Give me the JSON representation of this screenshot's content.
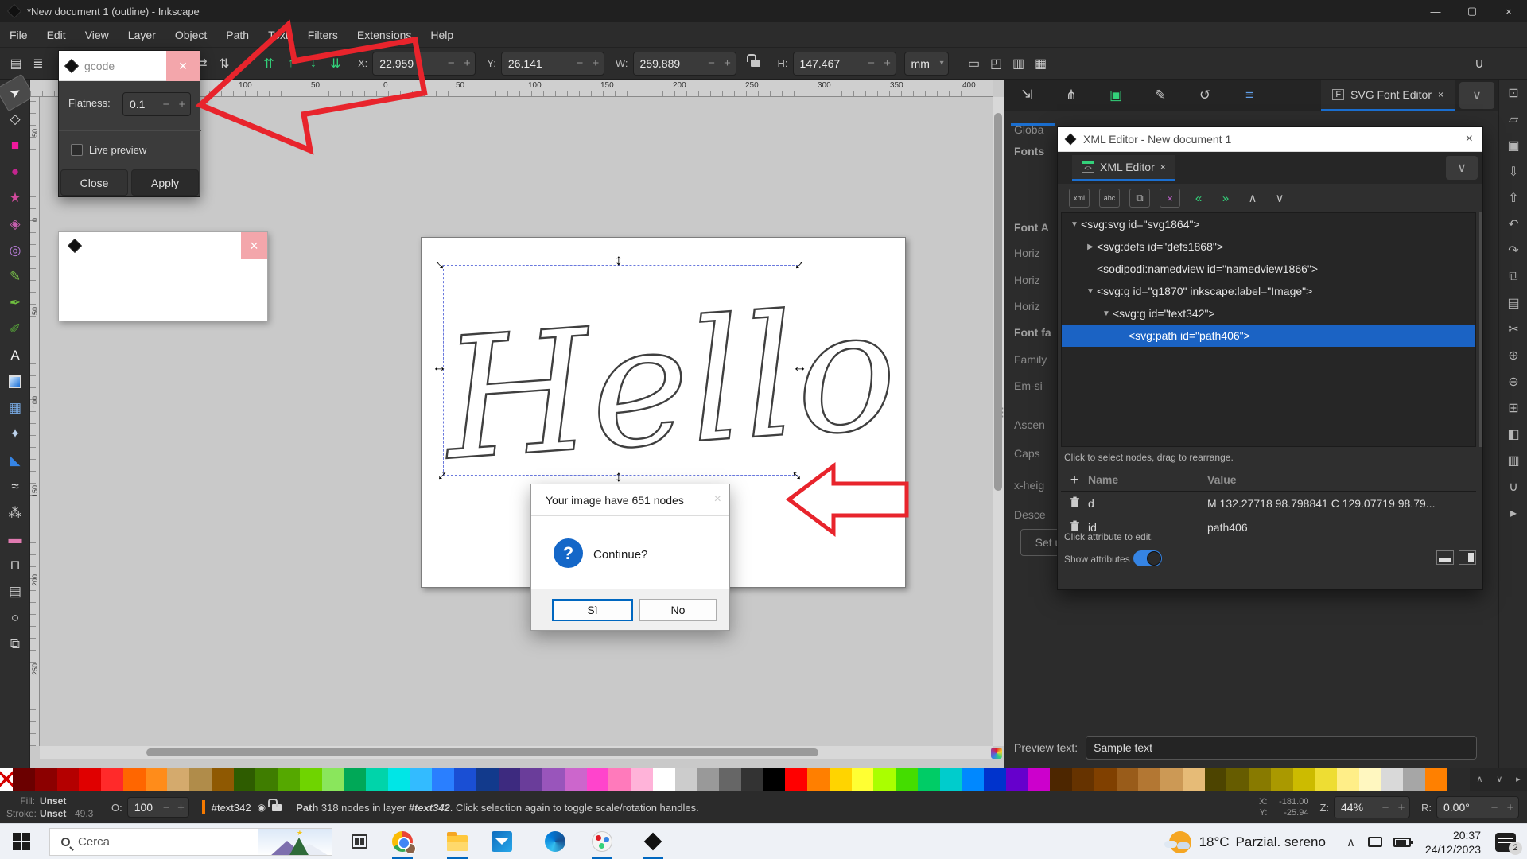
{
  "window": {
    "title": "*New document 1 (outline) - Inkscape"
  },
  "menus": [
    "File",
    "Edit",
    "View",
    "Layer",
    "Object",
    "Path",
    "Text",
    "Filters",
    "Extensions",
    "Help"
  ],
  "toolbar": {
    "x_label": "X:",
    "x_value": "22.959",
    "y_label": "Y:",
    "y_value": "26.141",
    "w_label": "W:",
    "w_value": "259.889",
    "h_label": "H:",
    "h_value": "147.467",
    "unit": "mm",
    "icons": [
      {
        "name": "object-properties-icon",
        "glyph": "▤"
      },
      {
        "name": "object-list-icon",
        "glyph": "≣"
      },
      {
        "name": "flip-horizontal-icon",
        "glyph": "⇄"
      },
      {
        "name": "flip-vertical-icon",
        "glyph": "⇅"
      },
      {
        "name": "raise-to-top-icon",
        "glyph": "⇈"
      },
      {
        "name": "raise-icon",
        "glyph": "↑"
      },
      {
        "name": "lower-icon",
        "glyph": "↓"
      },
      {
        "name": "lower-to-bottom-icon",
        "glyph": "⇊"
      },
      {
        "name": "scale-stroke-icon",
        "glyph": "▭"
      },
      {
        "name": "scale-corners-icon",
        "glyph": "◰"
      },
      {
        "name": "scale-gradient-icon",
        "glyph": "▥"
      },
      {
        "name": "scale-pattern-icon",
        "glyph": "▦"
      },
      {
        "name": "snapping-toggle-icon",
        "glyph": "∪"
      }
    ]
  },
  "gcode_dialog": {
    "title": "gcode",
    "flatness_label": "Flatness:",
    "flatness_value": "0.1",
    "live_preview_label": "Live preview",
    "close_label": "Close",
    "apply_label": "Apply"
  },
  "nodes_dialog": {
    "title": "Your image have 651 nodes",
    "question": "Continue?",
    "icon": "?",
    "yes_label": "Sì",
    "no_label": "No"
  },
  "canvas": {
    "text": "Hello",
    "h_ruler_labels": [
      "100",
      "50",
      "0",
      "50",
      "100",
      "150",
      "200",
      "250",
      "300",
      "350",
      "400"
    ],
    "v_ruler_labels": [
      "50",
      "0",
      "50",
      "100",
      "150",
      "200",
      "250"
    ]
  },
  "toolbox": [
    {
      "name": "selector-tool",
      "glyph": "➤",
      "color": "#ececec",
      "active": true
    },
    {
      "name": "node-editor-tool",
      "glyph": "◇",
      "color": "#d8d8d8"
    },
    {
      "name": "rectangle-tool",
      "glyph": "■",
      "color": "#f0189c"
    },
    {
      "name": "ellipse-tool",
      "glyph": "●",
      "color": "#c4258f"
    },
    {
      "name": "star-tool",
      "glyph": "★",
      "color": "#d04a9c"
    },
    {
      "name": "box3d-tool",
      "glyph": "◈",
      "color": "#c75fae"
    },
    {
      "name": "spiral-tool",
      "glyph": "◎",
      "color": "#b37ad2"
    },
    {
      "name": "pencil-tool",
      "glyph": "✎",
      "color": "#7ac24a"
    },
    {
      "name": "calligraphy-tool",
      "glyph": "✒",
      "color": "#6fbf3f"
    },
    {
      "name": "bezier-tool",
      "glyph": "✐",
      "color": "#58a93a"
    },
    {
      "name": "text-tool",
      "glyph": "A",
      "color": "#f2f2f2"
    },
    {
      "name": "gradient-tool",
      "glyph": "",
      "color": "#4a90d9"
    },
    {
      "name": "mesh-tool",
      "glyph": "▦",
      "color": "#77a8e0"
    },
    {
      "name": "dropper-tool",
      "glyph": "✦",
      "color": "#bcd2ec"
    },
    {
      "name": "paint-bucket-tool",
      "glyph": "◣",
      "color": "#3584e4"
    },
    {
      "name": "tweak-tool",
      "glyph": "≈",
      "color": "#e0e0e0"
    },
    {
      "name": "spray-tool",
      "glyph": "⁂",
      "color": "#cccccc"
    },
    {
      "name": "eraser-tool",
      "glyph": "▬",
      "color": "#e07ab0"
    },
    {
      "name": "connector-tool",
      "glyph": "⊓",
      "color": "#cccccc"
    },
    {
      "name": "page-tool",
      "glyph": "▤",
      "color": "#cccccc"
    },
    {
      "name": "zoom-tool",
      "glyph": "○",
      "color": "#e0e0e0"
    },
    {
      "name": "pages-tool",
      "glyph": "⧉",
      "color": "#cccccc"
    }
  ],
  "dock_tabs": {
    "icons": [
      {
        "name": "export-dialog-icon",
        "glyph": "⇲",
        "color": "#c8c8c8"
      },
      {
        "name": "trace-bitmap-icon",
        "glyph": "⋔",
        "color": "#c8c8c8"
      },
      {
        "name": "image-dialog-icon",
        "glyph": "▣",
        "color": "#33d17a"
      },
      {
        "name": "draw-dialog-icon",
        "glyph": "✎",
        "color": "#c8c8c8"
      },
      {
        "name": "undo-history-icon",
        "glyph": "↺",
        "color": "#c8c8c8"
      },
      {
        "name": "layers-dialog-icon",
        "glyph": "≡",
        "color": "#62a0ea"
      }
    ],
    "active_tab": "SVG Font Editor",
    "tab_icon": "F",
    "close_glyph": "×",
    "chevron": "∨"
  },
  "font_panel": {
    "labels": [
      {
        "text": "Globa",
        "bold": false
      },
      {
        "text": "Fonts",
        "bold": true
      },
      {
        "text": "Font A",
        "bold": true
      },
      {
        "text": "Horiz",
        "bold": false
      },
      {
        "text": "Horiz",
        "bold": false
      },
      {
        "text": "Horiz",
        "bold": false
      },
      {
        "text": "Font fa",
        "bold": true
      },
      {
        "text": "Family",
        "bold": false
      },
      {
        "text": "Em-si",
        "bold": false
      },
      {
        "text": "Ascen",
        "bold": false
      },
      {
        "text": "Caps",
        "bold": false
      },
      {
        "text": "x-heig",
        "bold": false
      },
      {
        "text": "Desce",
        "bold": false
      }
    ],
    "set_button": "Set u",
    "preview_label": "Preview text:",
    "preview_value": "Sample text"
  },
  "xml_editor": {
    "title": "XML Editor - New document 1",
    "tab_label": "XML Editor",
    "toolbar_icons": [
      {
        "name": "new-element-node-icon",
        "label": "xml",
        "boxed": true
      },
      {
        "name": "new-text-node-icon",
        "label": "abc",
        "boxed": true
      },
      {
        "name": "duplicate-node-icon",
        "label": "⧉",
        "boxed": true
      },
      {
        "name": "delete-node-icon",
        "label": "×",
        "boxed": true,
        "color": "#c061cb"
      },
      {
        "name": "unindent-node-icon",
        "label": "«",
        "boxed": false,
        "color": "#33d17a"
      },
      {
        "name": "indent-node-icon",
        "label": "»",
        "boxed": false,
        "color": "#33d17a"
      },
      {
        "name": "move-node-up-icon",
        "label": "∧",
        "boxed": false
      },
      {
        "name": "move-node-down-icon",
        "label": "∨",
        "boxed": false
      }
    ],
    "tree": [
      {
        "text": "<svg:svg id=\"svg1864\">",
        "indent": 0,
        "arrow": "down",
        "selected": false
      },
      {
        "text": "<svg:defs id=\"defs1868\">",
        "indent": 1,
        "arrow": "right",
        "selected": false
      },
      {
        "text": "<sodipodi:namedview id=\"namedview1866\">",
        "indent": 1,
        "arrow": "none",
        "selected": false
      },
      {
        "text": "<svg:g id=\"g1870\" inkscape:label=\"Image\">",
        "indent": 1,
        "arrow": "down",
        "selected": false
      },
      {
        "text": "<svg:g id=\"text342\">",
        "indent": 2,
        "arrow": "down",
        "selected": false
      },
      {
        "text": "<svg:path id=\"path406\">",
        "indent": 3,
        "arrow": "none",
        "selected": true
      }
    ],
    "nodes_hint": "Click to select nodes, drag to rearrange.",
    "attr_add": "+",
    "attr_name_header": "Name",
    "attr_value_header": "Value",
    "attributes": [
      {
        "name": "d",
        "value": "M 132.27718 98.798841 C 129.07719 98.79..."
      },
      {
        "name": "id",
        "value": "path406"
      }
    ],
    "attr_hint": "Click attribute to edit.",
    "show_attributes_label": "Show attributes"
  },
  "commands_bar": [
    {
      "name": "display-icon",
      "glyph": "⊡"
    },
    {
      "name": "open-file-icon",
      "glyph": "▱"
    },
    {
      "name": "save-icon",
      "glyph": "▣"
    },
    {
      "name": "import-icon",
      "glyph": "⇩"
    },
    {
      "name": "export-icon",
      "glyph": "⇧"
    },
    {
      "name": "undo-icon",
      "glyph": "↶"
    },
    {
      "name": "redo-icon",
      "glyph": "↷"
    },
    {
      "name": "copy-icon",
      "glyph": "⧉"
    },
    {
      "name": "paste-icon",
      "glyph": "▤"
    },
    {
      "name": "cut-icon",
      "glyph": "✂"
    },
    {
      "name": "zoom-in-icon",
      "glyph": "⊕"
    },
    {
      "name": "zoom-out-icon",
      "glyph": "⊖"
    },
    {
      "name": "zoom-page-icon",
      "glyph": "⊞"
    },
    {
      "name": "fill-stroke-icon",
      "glyph": "◧"
    },
    {
      "name": "dialogs-icon",
      "glyph": "▥"
    },
    {
      "name": "snap-icon",
      "glyph": "∪"
    },
    {
      "name": "expand-panel-icon",
      "glyph": "▸"
    }
  ],
  "palette_colors": [
    "#6b0000",
    "#8c0000",
    "#b40000",
    "#e00000",
    "#ff2a2a",
    "#ff6600",
    "#ff8c1a",
    "#d4aa6d",
    "#b08c4a",
    "#8f5902",
    "#2e5c00",
    "#3f7d00",
    "#55a800",
    "#6fd400",
    "#8ae65c",
    "#00a857",
    "#00d4aa",
    "#00e6e6",
    "#33bbff",
    "#2a7fff",
    "#1a4fd4",
    "#123a8c",
    "#3d2a7f",
    "#6a3d9a",
    "#9955bb",
    "#cc66cc",
    "#ff44cc",
    "#ff7abb",
    "#ffb3d9",
    "#ffffff",
    "#cccccc",
    "#999999",
    "#666666",
    "#333333",
    "#000000",
    "#ff0000",
    "#ff7f00",
    "#ffd400",
    "#ffff33",
    "#aaff00",
    "#44dd00",
    "#00cc66",
    "#00cccc",
    "#0088ff",
    "#0033cc",
    "#6600cc",
    "#cc00cc",
    "#4d2600",
    "#663300",
    "#804000",
    "#995c1a",
    "#b37733",
    "#cc9955",
    "#e6bb77",
    "#4d4400",
    "#665c00",
    "#887a00",
    "#aa9900",
    "#ccbb00",
    "#eedd33",
    "#ffee88",
    "#fff7c0",
    "#d9d9d9",
    "#a6a6a6",
    "#ff8000",
    "#2a2a2a"
  ],
  "statusbar": {
    "fill_label": "Fill:",
    "fill_value": "Unset",
    "stroke_label": "Stroke:",
    "stroke_value": "Unset",
    "stroke_width": "49.3",
    "opacity_label": "O:",
    "opacity_value": "100",
    "layer_name": "#text342",
    "message_parts": [
      {
        "text": "Path",
        "bold": true,
        "italic": false
      },
      {
        "text": " 318 nodes in layer ",
        "bold": false,
        "italic": false
      },
      {
        "text": "#text342",
        "bold": true,
        "italic": true
      },
      {
        "text": ". Click selection again to toggle scale/rotation handles.",
        "bold": false,
        "italic": false
      }
    ],
    "x_label": "X:",
    "x_value": "-181.00",
    "y_label": "Y:",
    "y_value": "-25.94",
    "zoom_label": "Z:",
    "zoom_value": "44%",
    "rotation_label": "R:",
    "rotation_value": "0.00°"
  },
  "taskbar": {
    "search_placeholder": "Cerca",
    "weather_temp": "18°C",
    "weather_desc": "Parzial. sereno",
    "time": "20:37",
    "date": "24/12/2023",
    "notification_badge": "2"
  },
  "colors": {
    "annotation_red": "#e8242c",
    "selection_blue": "#6a79dd",
    "accent_blue": "#1b6fd0"
  }
}
